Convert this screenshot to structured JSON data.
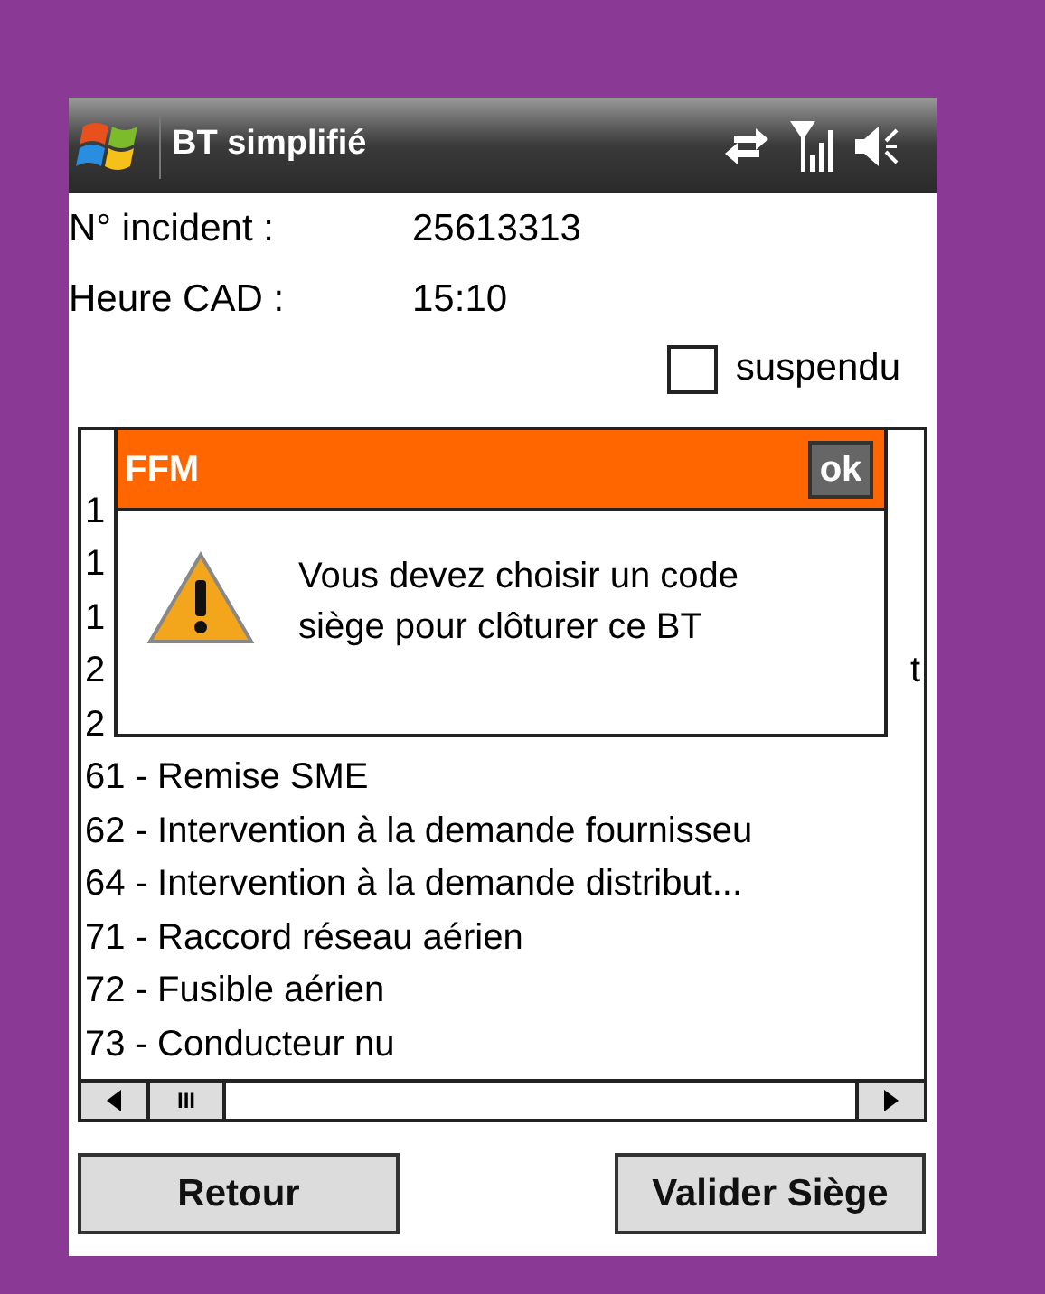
{
  "window": {
    "title": "BT simplifié"
  },
  "fields": [
    {
      "label": "N° incident :",
      "value": "25613313"
    },
    {
      "label": "Heure CAD :",
      "value": "15:10"
    }
  ],
  "suspendu": {
    "label": "suspendu",
    "checked": false
  },
  "list": {
    "items": [
      {
        "text": "1"
      },
      {
        "text": "1"
      },
      {
        "text": "1"
      },
      {
        "text": "2",
        "tail": "t"
      },
      {
        "text": "2"
      },
      {
        "text": "61 - Remise SME"
      },
      {
        "text": "62 - Intervention à la demande fournisseu"
      },
      {
        "text": "64 - Intervention à la demande distribut..."
      },
      {
        "text": "71 - Raccord réseau aérien"
      },
      {
        "text": "72 - Fusible aérien"
      },
      {
        "text": "73 - Conducteur nu"
      }
    ]
  },
  "scrollbar": {
    "thumb_label": "III"
  },
  "dialog": {
    "title": "FFM",
    "ok": "ok",
    "message": "Vous devez choisir un code siège pour clôturer ce BT"
  },
  "buttons": [
    {
      "label": "Retour"
    },
    {
      "label": "Valider Siège"
    }
  ]
}
